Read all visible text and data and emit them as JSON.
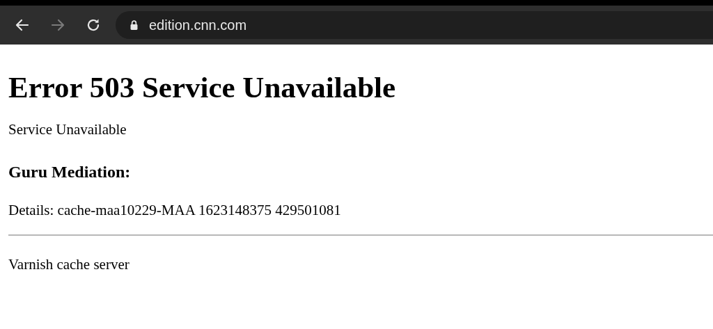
{
  "browser": {
    "back": {
      "disabled": false
    },
    "forward": {
      "disabled": true
    },
    "secure": true,
    "url": "edition.cnn.com"
  },
  "page": {
    "title": "Error 503 Service Unavailable",
    "message": "Service Unavailable",
    "heading": "Guru Mediation:",
    "details": "Details: cache-maa10229-MAA 1623148375 429501081",
    "footer": "Varnish cache server"
  }
}
